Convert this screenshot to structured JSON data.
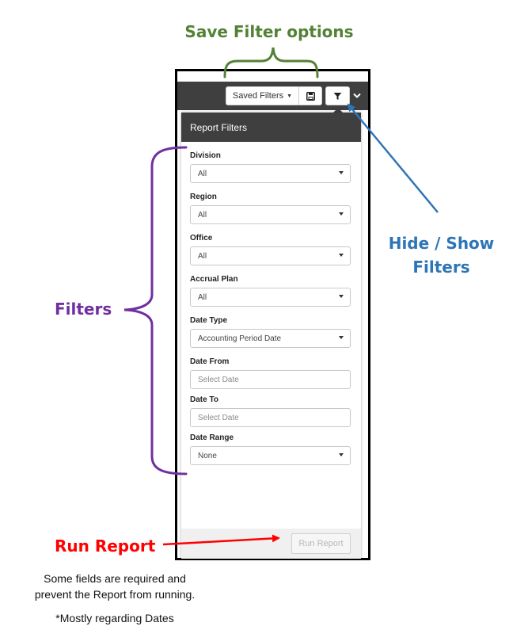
{
  "annotations": {
    "save_filter_options": "Save Filter options",
    "filters": "Filters",
    "hide_show_filters": "Hide / Show Filters",
    "run_report": "Run Report",
    "note_required": "Some fields are required and prevent the Report from running.",
    "note_dates": "*Mostly regarding Dates"
  },
  "colors": {
    "save_filter_options": "#538135",
    "filters": "#7030a0",
    "hide_show_filters": "#2e75b6",
    "run_report": "#ff0000",
    "toolbar": "#3f3f3f"
  },
  "toolbar": {
    "saved_filters_label": "Saved Filters",
    "save_icon": "floppy-disk-icon",
    "filter_icon": "funnel-icon",
    "collapse_icon": "chevron-down-icon"
  },
  "panel": {
    "title": "Report Filters",
    "fields": {
      "division": {
        "label": "Division",
        "value": "All"
      },
      "region": {
        "label": "Region",
        "value": "All"
      },
      "office": {
        "label": "Office",
        "value": "All"
      },
      "accrual_plan": {
        "label": "Accrual Plan",
        "value": "All"
      },
      "date_type": {
        "label": "Date Type",
        "value": "Accounting Period Date"
      },
      "date_from": {
        "label": "Date From",
        "placeholder": "Select Date"
      },
      "date_to": {
        "label": "Date To",
        "placeholder": "Select Date"
      },
      "date_range": {
        "label": "Date Range",
        "value": "None"
      }
    },
    "run_report_label": "Run Report"
  }
}
